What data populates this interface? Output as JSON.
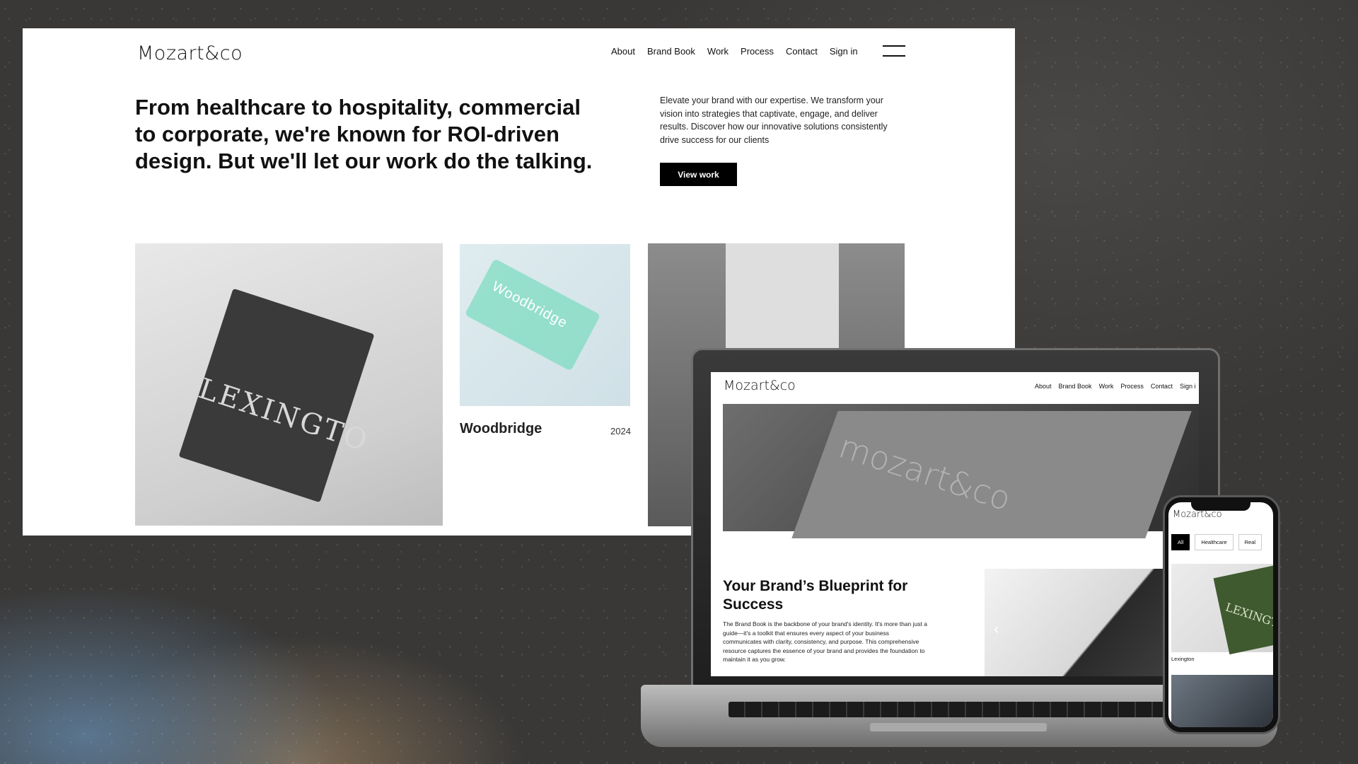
{
  "desktop": {
    "logo": "Mozart&co",
    "nav": [
      "About",
      "Brand Book",
      "Work",
      "Process",
      "Contact",
      "Sign in"
    ],
    "headline": "From healthcare to hospitality, commercial to corporate, we're known for ROI-driven design. But we'll let our work do the talking.",
    "intro": "Elevate your brand with our expertise. We transform your vision into strategies that captivate, engage, and deliver results. Discover how our innovative solutions consistently drive success for our clients",
    "cta": "View work",
    "cards": [
      {
        "image_text": "LEXINGTO"
      },
      {
        "title": "Woodbridge",
        "year": "2024",
        "image_text": "Woodbridge"
      },
      {
        "image_text": ""
      }
    ]
  },
  "laptop": {
    "logo": "Mozart&co",
    "nav": [
      "About",
      "Brand Book",
      "Work",
      "Process",
      "Contact",
      "Sign i"
    ],
    "hero_text": "mozart&co",
    "section_title": "Your Brand’s Blueprint for Success",
    "section_body": "The Brand Book is the backbone of your brand's identity. It's more than just a guide—it's a toolkit that ensures every aspect of your business communicates with clarity, consistency, and purpose. This comprehensive resource captures the essence of your brand and provides the foundation to maintain it as you grow.",
    "prev_glyph": "‹"
  },
  "phone": {
    "logo": "Mozart&co",
    "filters": [
      "All",
      "Healthcare",
      "Real"
    ],
    "image_text": "LEXINGTO",
    "caption": "Lexington"
  }
}
